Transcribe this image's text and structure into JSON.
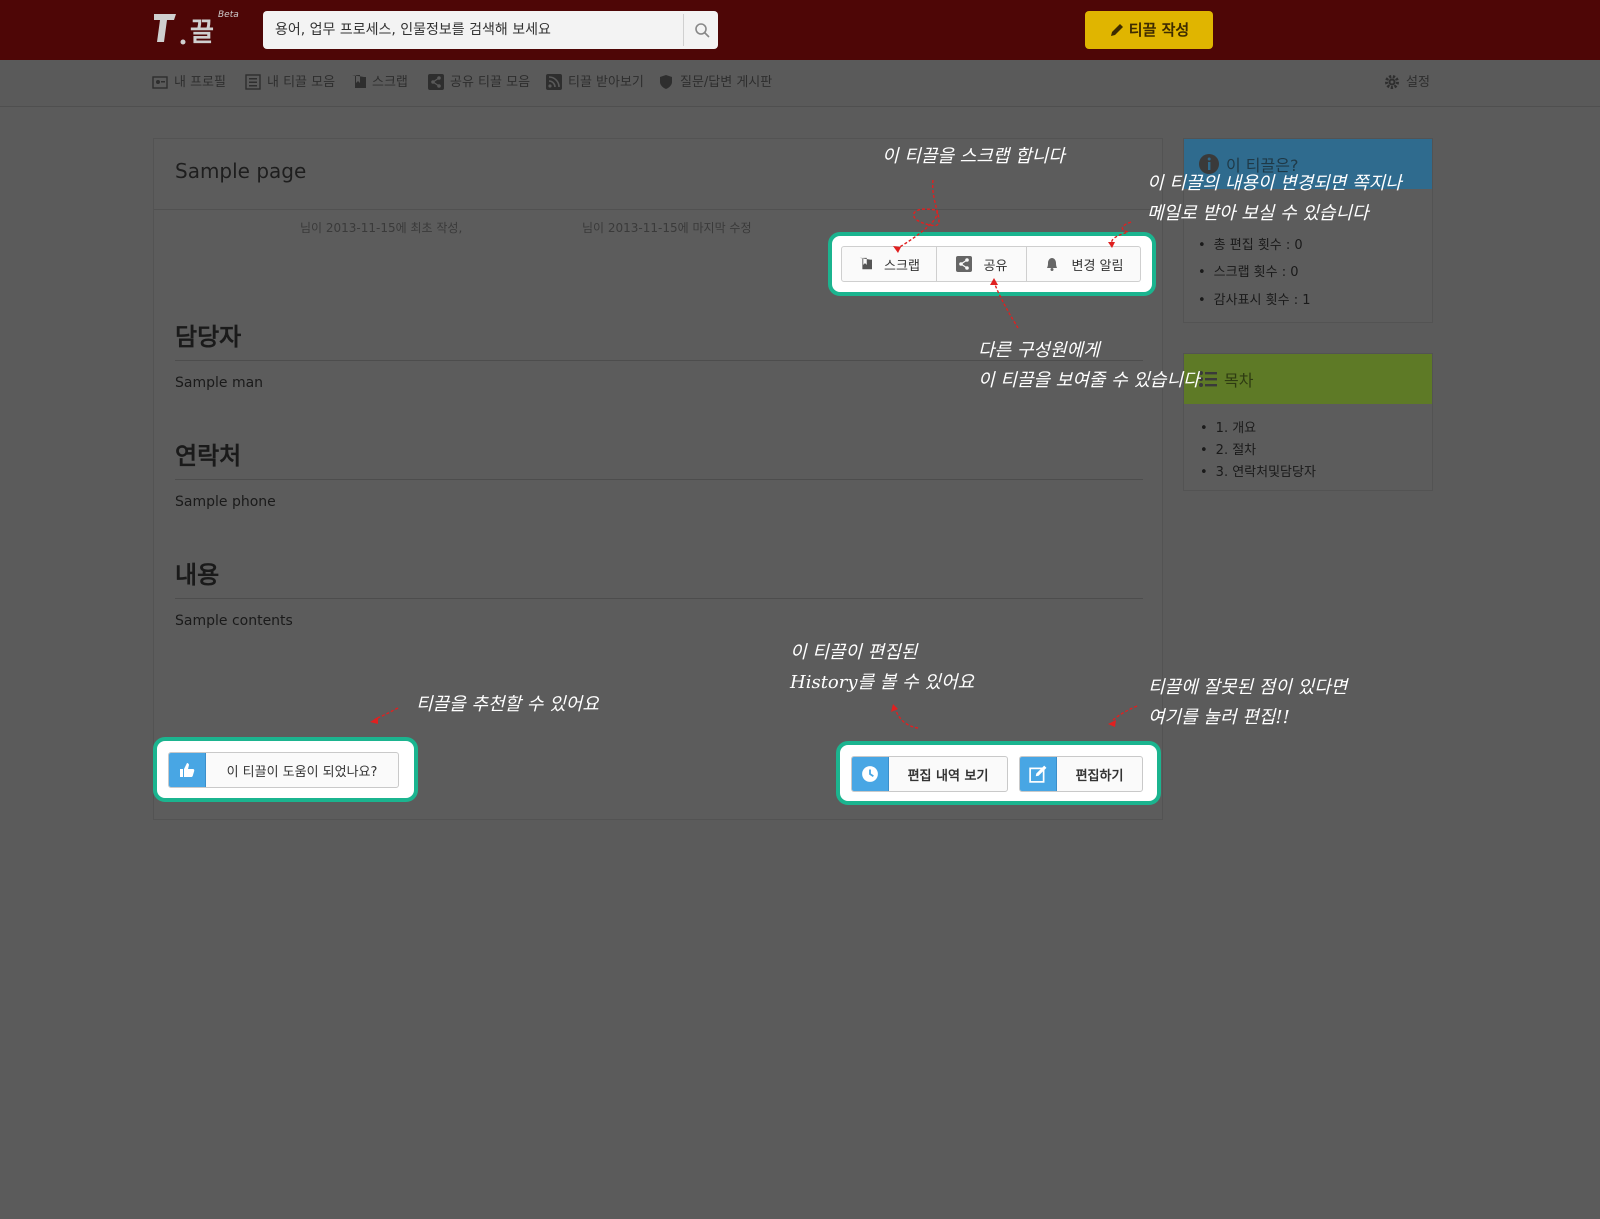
{
  "header": {
    "logo_text": "끌",
    "logo_badge": "Beta",
    "search_placeholder": "용어, 업무 프로세스, 인물정보를 검색해 보세요",
    "write_label": "티끌 작성"
  },
  "nav": {
    "items": [
      {
        "label": "내 프로필",
        "icon": "profile-icon"
      },
      {
        "label": "내 티끌 모음",
        "icon": "list-icon"
      },
      {
        "label": "스크랩",
        "icon": "bookmark-icon"
      },
      {
        "label": "공유 티끌 모음",
        "icon": "share-icon"
      },
      {
        "label": "티끌 받아보기",
        "icon": "rss-icon"
      },
      {
        "label": "질문/답변 게시판",
        "icon": "shield-icon"
      }
    ],
    "settings_label": "설정"
  },
  "page": {
    "title": "Sample page",
    "meta_created": "님이 2013-11-15에 최초 작성,",
    "meta_updated": "님이 2013-11-15에 마지막 수정",
    "actions": {
      "scrap": "스크랩",
      "share": "공유",
      "notify": "변경 알림"
    },
    "sections": [
      {
        "heading": "담당자",
        "text": "Sample man"
      },
      {
        "heading": "연락처",
        "text": "Sample phone"
      },
      {
        "heading": "내용",
        "text": "Sample contents"
      }
    ],
    "helpful_label": "이 티끌이 도움이 되었나요?",
    "history_label": "편집 내역 보기",
    "edit_label": "편집하기"
  },
  "info_panel": {
    "title": "이 티끌은?",
    "stats": [
      "총 편집 횟수 : 0",
      "스크랩 횟수 : 0",
      "감사표시 횟수 : 1"
    ]
  },
  "toc_panel": {
    "title": "목차",
    "items": [
      "1. 개요",
      "2. 절차",
      "3. 연락처및담당자"
    ]
  },
  "annotations": {
    "scrap": "이 티끌을 스크랩 합니다",
    "notify_1": "이 티끌의 내용이 변경되면 쪽지나",
    "notify_2": "메일로 받아 보실 수 있습니다",
    "share_1": "다른 구성원에게",
    "share_2": "이 티끌을 보여줄 수 있습니다",
    "history_1": "이 티끌이 편집된",
    "history_2": "History를 볼 수 있어요",
    "recommend": "티끌을 추천할 수 있어요",
    "edit_1": "티끌에 잘못된 점이 있다면",
    "edit_2": "여기를 눌러 편집!!"
  },
  "colors": {
    "header_bg": "#4e0606",
    "accent_yellow": "#e0b500",
    "highlight": "#1bb48f",
    "info_header": "#2f6b8e",
    "toc_header": "#5e7a26",
    "icon_blue": "#48a6e4",
    "annotation_arrow": "#e02020"
  }
}
